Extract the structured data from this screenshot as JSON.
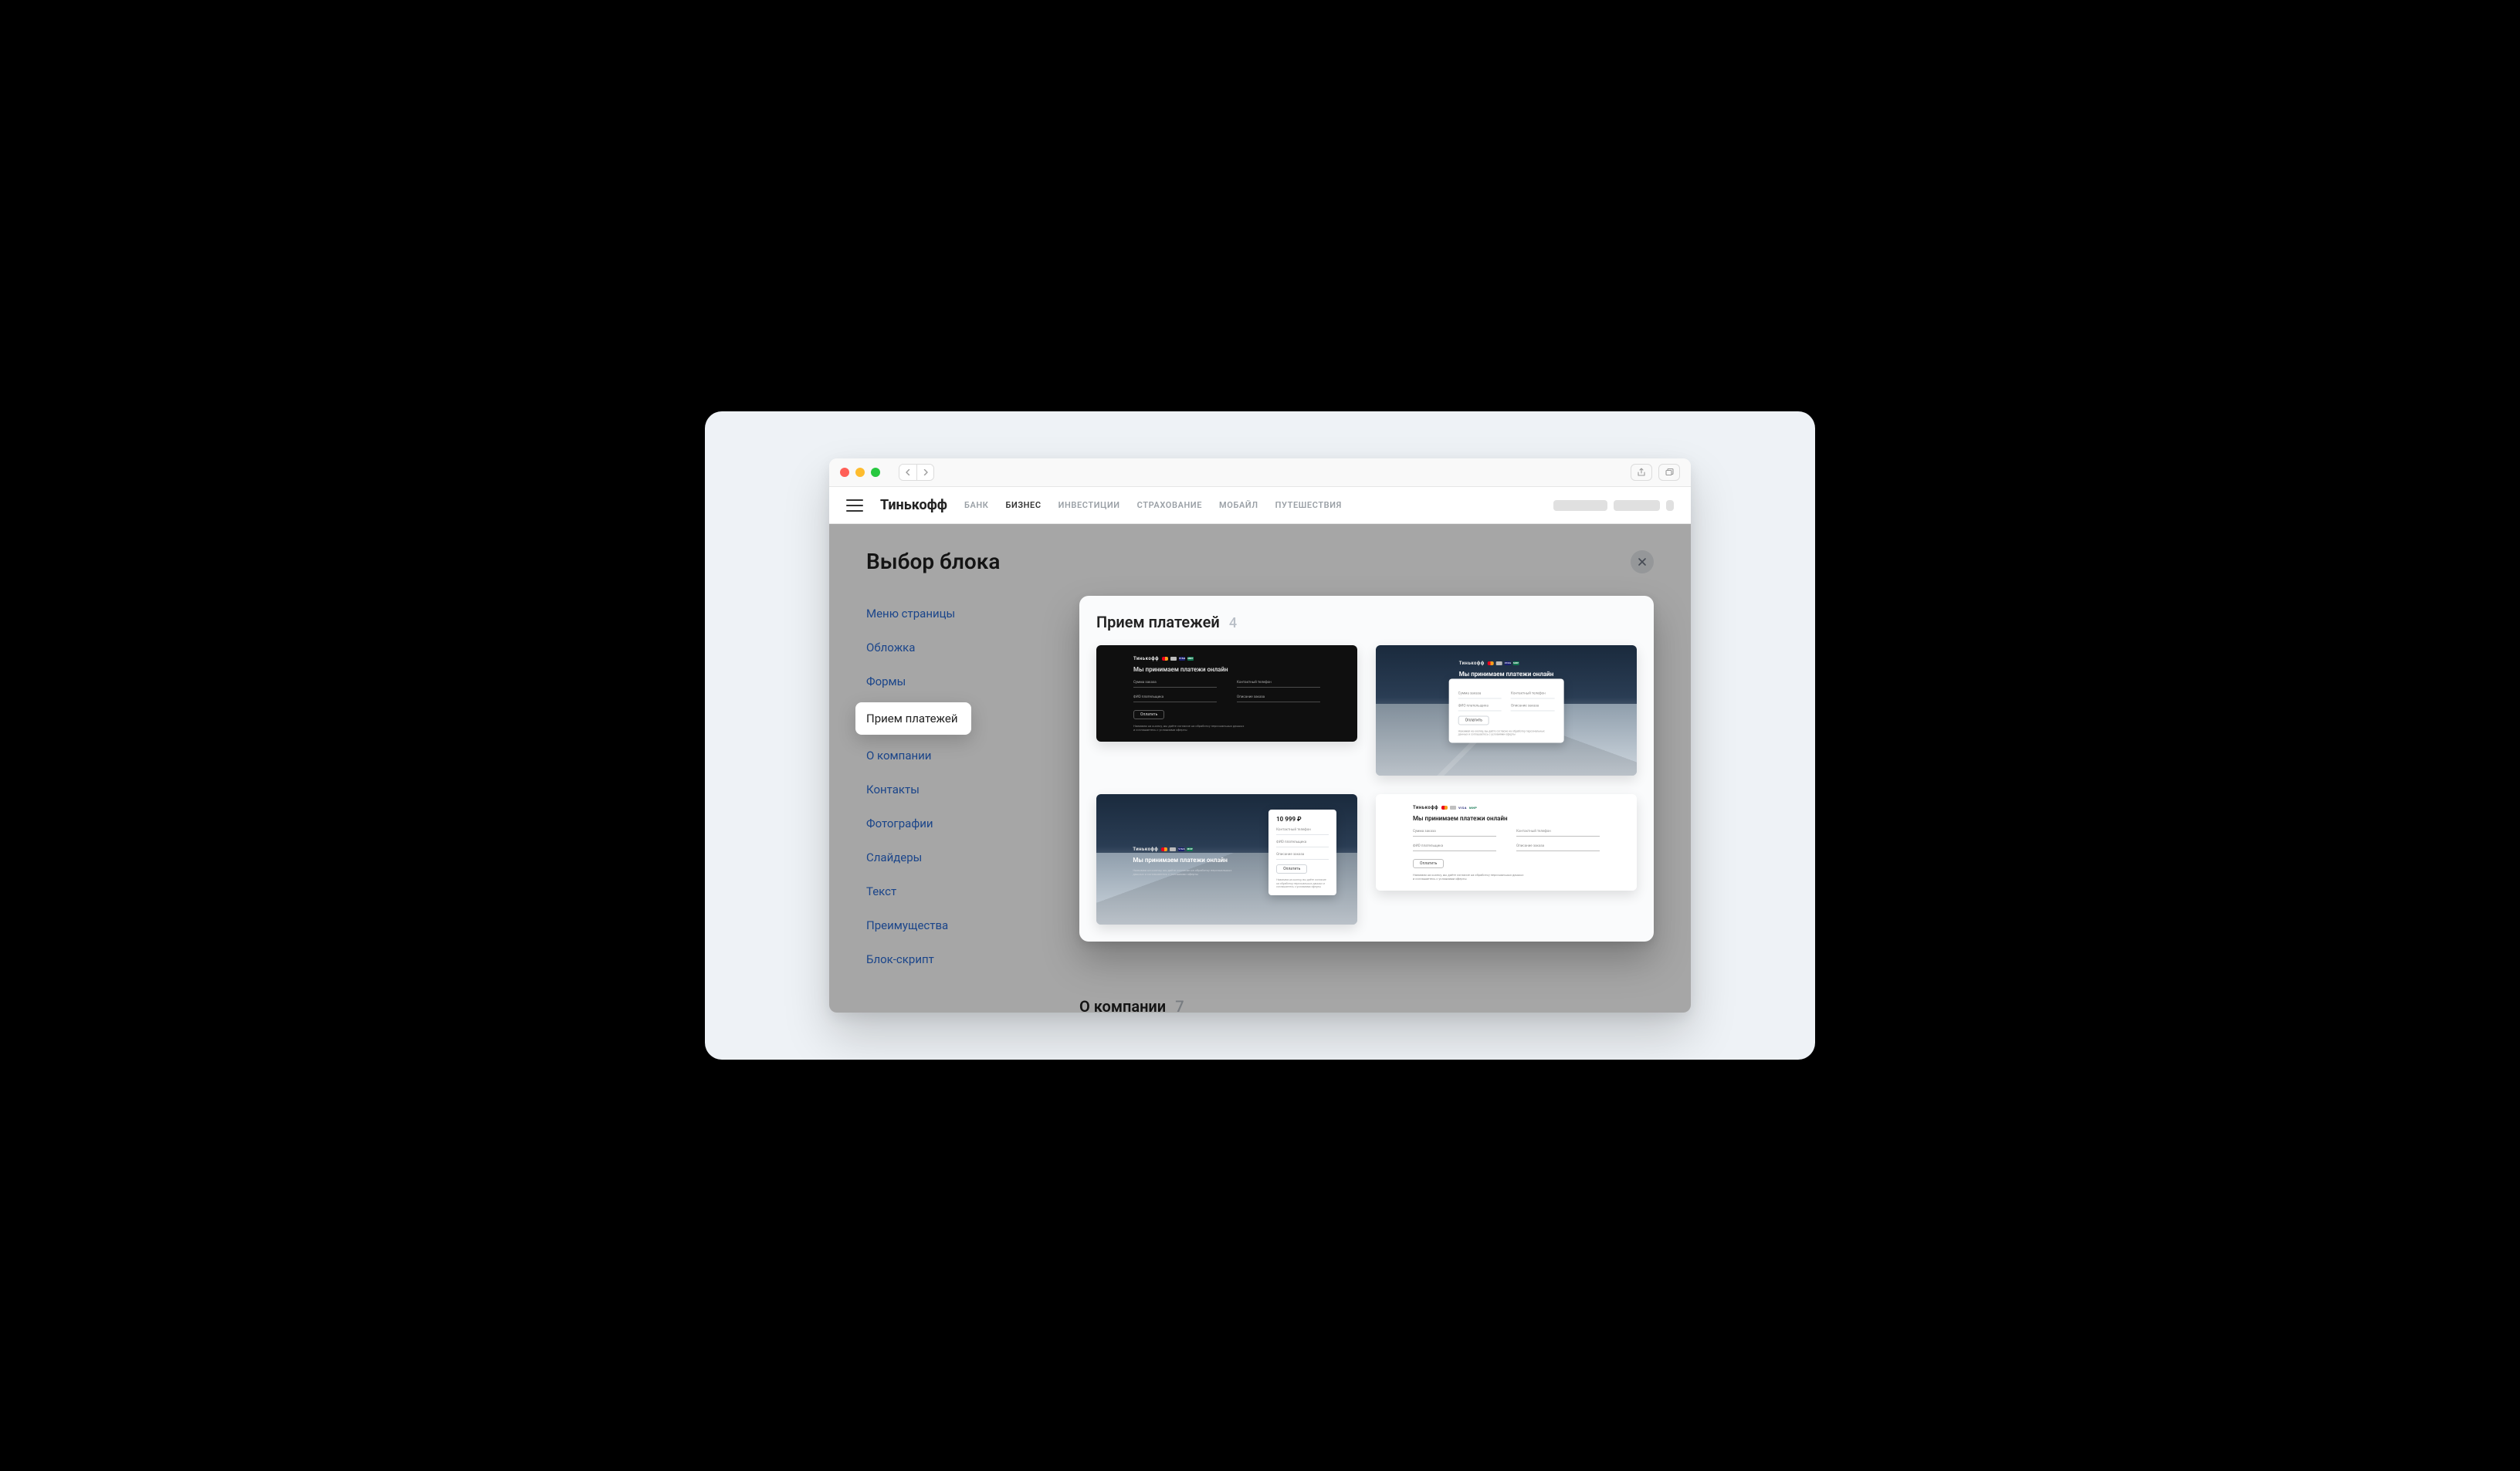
{
  "brand": "Тинькофф",
  "top_nav": {
    "items": [
      "БАНК",
      "БИЗНЕС",
      "ИНВЕСТИЦИИ",
      "СТРАХОВАНИЕ",
      "МОБАЙЛ",
      "ПУТЕШЕСТВИЯ"
    ],
    "active_index": 1
  },
  "page": {
    "title": "Выбор блока",
    "close_aria": "Закрыть"
  },
  "sidebar": {
    "items": [
      "Меню страницы",
      "Обложка",
      "Формы",
      "Прием платежей",
      "О компании",
      "Контакты",
      "Фотографии",
      "Слайдеры",
      "Текст",
      "Преимущества",
      "Блок-скрипт"
    ],
    "selected_index": 3
  },
  "popover": {
    "title": "Прием платежей",
    "count": "4",
    "block": {
      "brand": "Тинькофф",
      "payment_icons": [
        "mc",
        "cd",
        "visa",
        "mir"
      ],
      "heading": "Мы принимаем платежи онлайн",
      "fields": {
        "amount": "Сумма заказа",
        "phone": "Контактный телефон",
        "fio": "ФИО плательщика",
        "desc": "Описание заказа"
      },
      "button": "Оплатить",
      "note": "Нажимая на кнопку, вы даёте согласие на обработку персональных данных и соглашаетесь с условиями оферты",
      "price": "10 999 ₽"
    }
  },
  "below_section": {
    "title": "О компании",
    "count": "7"
  }
}
